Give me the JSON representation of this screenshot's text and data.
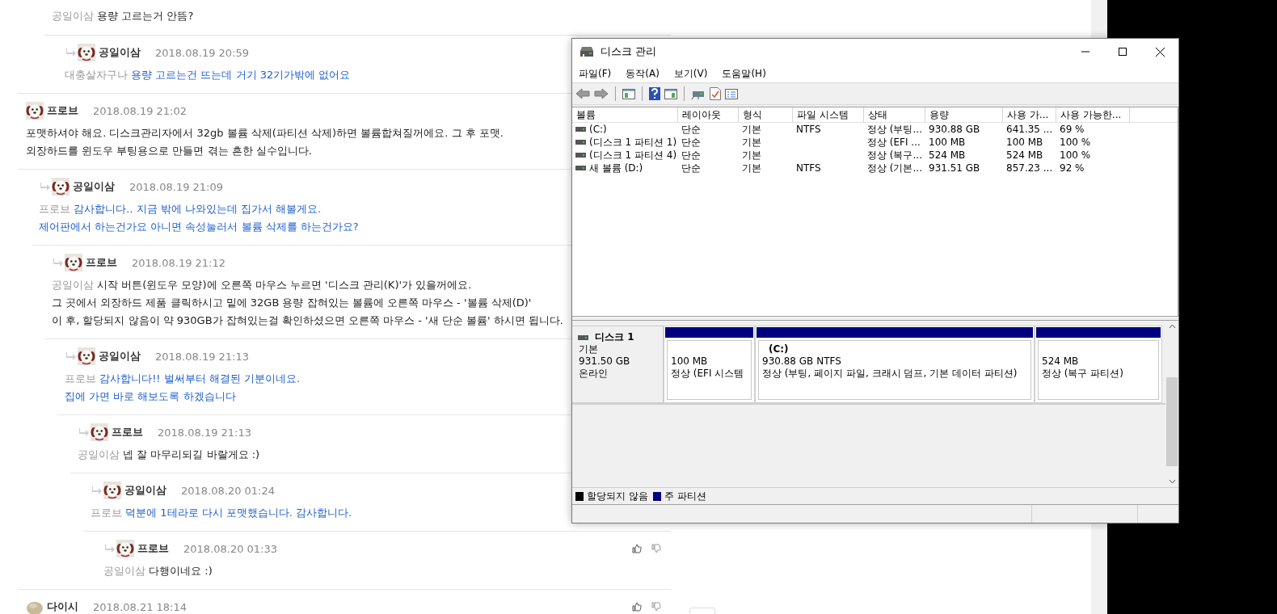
{
  "comments": [
    {
      "children": [
        {
          "children": [
            {
              "mention": "공일이삼",
              "lines": [
                "용량 고르는거 안뜸?"
              ],
              "op": false,
              "children": [
                {
                  "kind": "puppy",
                  "author": "공일이삼",
                  "date": "2018.08.19 20:59",
                  "mention": "대충살자구나",
                  "lines": [
                    "용량 고르는건 뜨는데 거기 32기가밖에 없어요"
                  ],
                  "op": true
                }
              ]
            }
          ]
        }
      ]
    },
    {
      "kind": "puppy",
      "author": "프로브",
      "date": "2018.08.19 21:02",
      "lines": [
        "포맷하셔야 해요. 디스크관리자에서 32gb 볼륨 삭제(파티션 삭제)하면 볼륨합쳐질꺼에요. 그 후 포맷.",
        "외장하드를 윈도우 부팅용으로 만들면 겪는 흔한 실수입니다."
      ],
      "op": false,
      "children": [
        {
          "kind": "puppy",
          "author": "공일이삼",
          "date": "2018.08.19 21:09",
          "mention": "프로브",
          "lines": [
            "감사합니다.. 지금 밖에 나와있는데 집가서 해볼게요.",
            "제어판에서 하는건가요 아니면 속성눌러서 볼륨 삭제를 하는건가요?"
          ],
          "op": true,
          "children": [
            {
              "kind": "puppy",
              "author": "프로브",
              "date": "2018.08.19 21:12",
              "mention": "공일이삼",
              "lines": [
                "시작 버튼(윈도우 모양)에 오른쪽 마우스 누르면 '디스크 관리(K)'가 있을꺼에요.",
                "그 곳에서 외장하드 제품 클릭하시고 밑에 32GB 용량 잡혀있는 볼륨에 오른쪽 마우스 - '볼륨 삭제(D)'",
                "이 후, 할당되지 않음이 약 930GB가 잡혀있는걸 확인하셨으면 오른쪽 마우스 - '새 단순 볼륨' 하시면 됩니다."
              ],
              "op": false,
              "children": [
                {
                  "kind": "puppy",
                  "author": "공일이삼",
                  "date": "2018.08.19 21:13",
                  "mention": "프로브",
                  "lines": [
                    "감사합니다!! 벌써부터 해결된 기분이네요.",
                    "집에 가면 바로 해보도록 하겠습니다"
                  ],
                  "op": true,
                  "children": [
                    {
                      "kind": "puppy",
                      "author": "프로브",
                      "date": "2018.08.19 21:13",
                      "mention": "공일이삼",
                      "lines": [
                        "넵 잘 마무리되길 바랄게요 :)"
                      ],
                      "op": false,
                      "children": [
                        {
                          "kind": "puppy",
                          "author": "공일이삼",
                          "date": "2018.08.20 01:24",
                          "mention": "프로브",
                          "lines": [
                            "덕분에 1테라로 다시 포맷했습니다. 감사합니다."
                          ],
                          "op": true,
                          "children": [
                            {
                              "kind": "puppy",
                              "author": "프로브",
                              "date": "2018.08.20 01:33",
                              "mention": "공일이삼",
                              "lines": [
                                "다행이네요 :)"
                              ],
                              "op": false
                            }
                          ]
                        }
                      ]
                    }
                  ]
                }
              ]
            }
          ]
        }
      ]
    },
    {
      "kind": "stone",
      "author": "다이시",
      "date": "2018.08.21 18:14"
    }
  ],
  "disk_window": {
    "title": "디스크 관리",
    "menu": [
      {
        "label": "파일(F)"
      },
      {
        "label": "동작(A)"
      },
      {
        "label": "보기(V)"
      },
      {
        "label": "도움말(H)"
      }
    ],
    "volume_table": {
      "columns": [
        "볼륨",
        "레이아웃",
        "형식",
        "파일 시스템",
        "상태",
        "용량",
        "사용 가...",
        "사용 가능한..."
      ],
      "rows": [
        {
          "cells": [
            "(C:)",
            "단순",
            "기본",
            "NTFS",
            "정상 (부팅...",
            "930.88 GB",
            "641.35 ...",
            "69 %"
          ]
        },
        {
          "cells": [
            "(디스크 1 파티션 1)",
            "단순",
            "기본",
            "",
            "정상 (EFI ...",
            "100 MB",
            "100 MB",
            "100 %"
          ]
        },
        {
          "cells": [
            "(디스크 1 파티션 4)",
            "단순",
            "기본",
            "",
            "정상 (복구...",
            "524 MB",
            "524 MB",
            "100 %"
          ]
        },
        {
          "cells": [
            "새 볼륨 (D:)",
            "단순",
            "기본",
            "NTFS",
            "정상 (기본...",
            "931.51 GB",
            "857.23 ...",
            "92 %"
          ]
        }
      ]
    },
    "disk_map": {
      "disk": {
        "name": "디스크 1",
        "type": "기본",
        "size": "931.50 GB",
        "status": "온라인"
      },
      "partitions": [
        {
          "size": "100 MB",
          "status": "정상 (EFI 시스템",
          "color": "#000080"
        },
        {
          "name": "(C:)",
          "size": "930.88 GB NTFS",
          "status": "정상 (부팅, 페이지 파일, 크래시 덤프, 기본 데이터 파티션)",
          "color": "#000080"
        },
        {
          "size": "524 MB",
          "status": "정상 (복구 파티션)",
          "color": "#000080"
        }
      ]
    },
    "legend": [
      {
        "label": "할당되지 않음",
        "color": "#000000"
      },
      {
        "label": "주 파티션",
        "color": "#000080"
      }
    ]
  }
}
